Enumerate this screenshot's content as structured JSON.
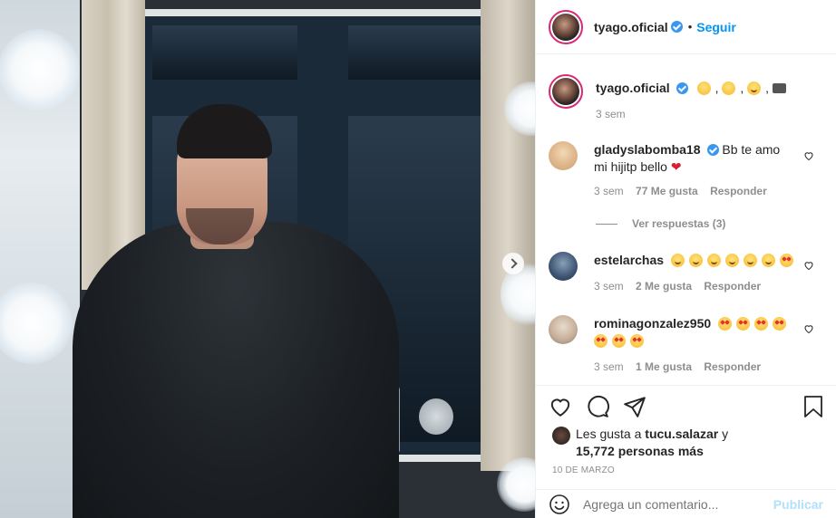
{
  "post": {
    "username": "tyago.oficial",
    "follow_label": "Seguir",
    "dot": "•"
  },
  "caption": {
    "username": "tyago.oficial",
    "suffix": ", , , ",
    "time": "3 sem"
  },
  "comments": [
    {
      "username": "gladyslabomba18",
      "verified": true,
      "text": "Bb te amo mi hijitp bello",
      "time": "3 sem",
      "likes": "77 Me gusta",
      "reply": "Responder"
    },
    {
      "username": "estelarchas",
      "verified": false,
      "text": "",
      "time": "3 sem",
      "likes": "2 Me gusta",
      "reply": "Responder"
    },
    {
      "username": "rominagonzalez950",
      "verified": false,
      "text": "",
      "time": "3 sem",
      "likes": "1 Me gusta",
      "reply": "Responder"
    }
  ],
  "view_replies": "Ver respuestas (3)",
  "likes": {
    "prefix": "Les gusta a ",
    "user": "tucu.salazar",
    "middle": " y",
    "count": "15,772 personas más"
  },
  "date": "10 DE MARZO",
  "add_comment": {
    "placeholder": "Agrega un comentario...",
    "publish_label": "Publicar"
  },
  "icons": {
    "like": "heart-icon",
    "comment": "comment-icon",
    "share": "send-icon",
    "save": "bookmark-icon",
    "emoji": "emoji-icon",
    "next": "chevron-right-icon"
  },
  "colors": {
    "accent": "#0095f6",
    "verified": "#3897f0",
    "muted": "#8e8e8e",
    "publish_disabled": "#b2dffc"
  }
}
